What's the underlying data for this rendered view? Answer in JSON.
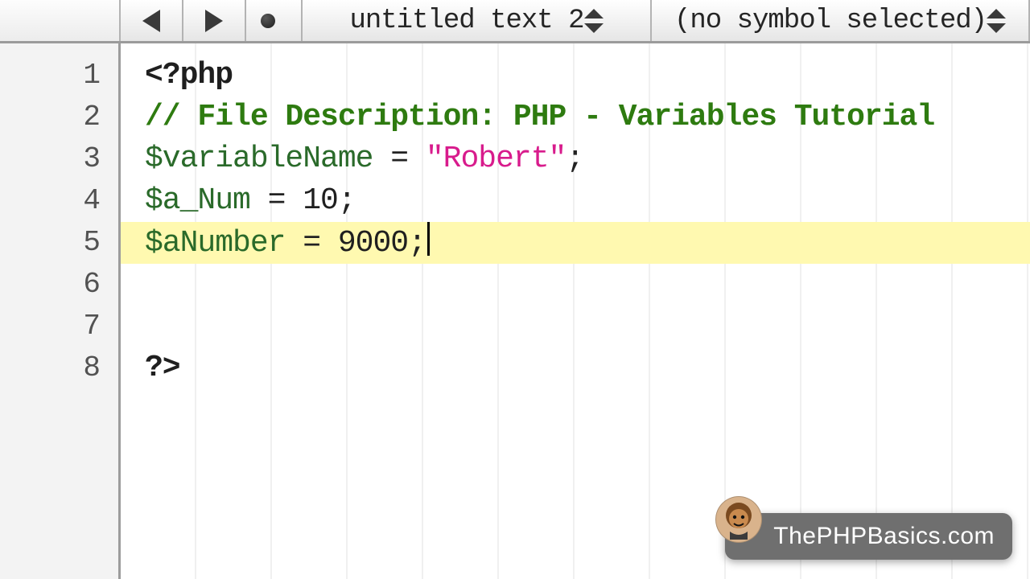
{
  "toolbar": {
    "file_name": "untitled text 2",
    "symbol_selector": "(no symbol selected)"
  },
  "editor": {
    "highlighted_line": 5,
    "line_count": 8,
    "lines": [
      {
        "n": 1,
        "tokens": [
          {
            "cls": "tk-kw",
            "t": "<?php"
          }
        ]
      },
      {
        "n": 2,
        "tokens": [
          {
            "cls": "tk-comment",
            "t": "// File Description: PHP - Variables Tutorial"
          }
        ]
      },
      {
        "n": 3,
        "tokens": [
          {
            "cls": "tk-var",
            "t": "$variableName"
          },
          {
            "cls": "tk-op",
            "t": " = "
          },
          {
            "cls": "tk-str",
            "t": "\"Robert\""
          },
          {
            "cls": "tk-punc",
            "t": ";"
          }
        ]
      },
      {
        "n": 4,
        "tokens": [
          {
            "cls": "tk-var",
            "t": "$a_Num"
          },
          {
            "cls": "tk-op",
            "t": " = "
          },
          {
            "cls": "tk-num",
            "t": "10"
          },
          {
            "cls": "tk-punc",
            "t": ";"
          }
        ]
      },
      {
        "n": 5,
        "tokens": [
          {
            "cls": "tk-var",
            "t": "$aNumber"
          },
          {
            "cls": "tk-op",
            "t": " = "
          },
          {
            "cls": "tk-num",
            "t": "9000"
          },
          {
            "cls": "tk-punc",
            "t": ";"
          }
        ]
      },
      {
        "n": 6,
        "tokens": []
      },
      {
        "n": 7,
        "tokens": []
      },
      {
        "n": 8,
        "tokens": [
          {
            "cls": "tk-kw",
            "t": "?>"
          }
        ]
      }
    ]
  },
  "watermark": {
    "text": "ThePHPBasics.com"
  }
}
